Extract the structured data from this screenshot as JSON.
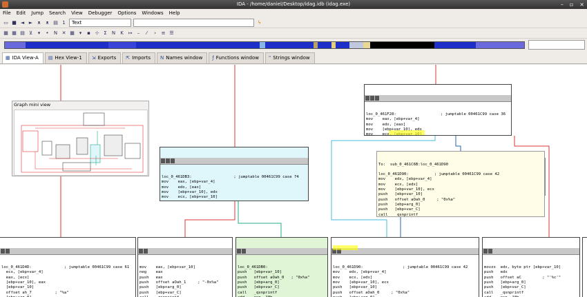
{
  "window": {
    "title": "IDA - /home/daniel/Desktop/idag.idb (idag.exe)"
  },
  "menu": [
    "File",
    "Edit",
    "Jump",
    "Search",
    "View",
    "Debugger",
    "Options",
    "Windows",
    "Help"
  ],
  "toolbar": {
    "segment_value": "Text",
    "address_value": "1"
  },
  "tabs": [
    {
      "label": "IDA View-A",
      "icon": "ida-view-icon"
    },
    {
      "label": "Hex View-1",
      "icon": "hex-view-icon"
    },
    {
      "label": "Exports",
      "icon": "exports-icon"
    },
    {
      "label": "Imports",
      "icon": "imports-icon"
    },
    {
      "label": "Names window",
      "icon": "names-icon"
    },
    {
      "label": "Functions window",
      "icon": "functions-icon"
    },
    {
      "label": "Strings window",
      "icon": "strings-icon"
    }
  ],
  "minimap": {
    "title": "Graph mini view"
  },
  "nodes": {
    "top_right": "loc_0_461F28:                   ; jumptable 00461C99 case 36\nmov    eax, [ebp+var_4]\nmov    edx, [eax]\nmov    [ebp+var_10], edx\nmov    ecx, [ebp+var_10]\ncmp    ecx, 0FFh\njg     loc_0_461D90       ; jumptable 00461C99 case 42",
    "middle": "loc_0_461DB3:                  ; jumptable 00461C99 case 74\nmov    eax, [ebp+var_4]\nmov    edx, [eax]\nmov    [ebp+var_10], edx\nmov    ecx, [ebp+var_10]\ntest   ecx, ecx\njge    short loc_0_461DB0",
    "tooltip": "To:  sub_0_461C6B:loc_0_461D90\n\nloc_0_461D90:           ; jumptable 00461C99 case 42\nmov    edx, [ebp+var_4]\nmov    ecx, [edx]\nmov    [ebp+var_10], ecx\npush   [ebp+var_10]\npush   offset aOah_0     ; \"0x%a\"\npush   [ebp+arg_0]\npush   [ebp+var_C]\ncall   _qsnprintf\nadd    esp, 10h\njmp    loc_0_461F7A",
    "bottom1": "loc_0_461D4D:              ; jumptable 00461C99 case 61\n  ecx, [ebp+var_4]\n  eax, [ecx]\n  [ebp+var_10], eax\n  [ebp+var_10]\n  offset ah_7          ; \"%a\"\n  [ebp+arg_0]\n  [ebp+var_C]\n  _qsnprintf",
    "bottom2": "mov    eax, [ebp+var_10]\nneg    eax\npush   eax\npush   offset aOah_1     ; \"-0x%a\"\npush   [ebp+arg_0]\npush   [ebp+var_C]\ncall   _qsnprintf\nadd    esp, 10h\njmp    loc_0_461F7A",
    "bottom3": "loc_0_461DB0:\npush   [ebp+var_10]\npush   offset aOah_0   ; \"0x%a\"\npush   [ebp+arg_0]\npush   [ebp+var_C]\ncall   _qsnprintf\nadd    esp, 10h\njmp    loc_0_461F7A",
    "bottom4": "loc_0_461D90:                 ; jumptable 00461C99 case 42\nmov    edx, [ebp+var_4]\nmov    ecx, [edx]\nmov    [ebp+var_10], ecx\npush   [ebp+var_10]\npush   offset aOah_0     ; \"0x%a\"\npush   [ebp+arg_0]\npush   [ebp+var_C]\ncall   _qsnprintf",
    "bottom5": "movzx  edx, byte ptr [ebp+var_10]\npush   edx\npush   offset aC         ; \"'%c'\"\npush   [ebp+arg_0]\npush   [ebp+var_C]\ncall   _qsnprintf\nadd    esp, 10h\njmp    short loc_0_461F7A"
  },
  "colors": {
    "blue": "#dff6fb",
    "yellow": "#fffde7",
    "green": "#dff5d6",
    "highlight": "#ffff00"
  }
}
